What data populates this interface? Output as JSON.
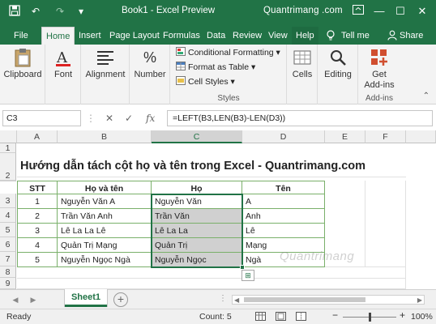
{
  "titlebar": {
    "title": "Book1 - Excel Preview",
    "brand": "Quantrimang .com",
    "undo_glyph": "↶",
    "redo_glyph": "↷",
    "qat_more_glyph": "▾",
    "minimize_glyph": "—",
    "restore_glyph": "☐",
    "close_glyph": "✕"
  },
  "tabs": [
    {
      "label": "File"
    },
    {
      "label": "Home"
    },
    {
      "label": "Insert"
    },
    {
      "label": "Page Layout"
    },
    {
      "label": "Formulas"
    },
    {
      "label": "Data"
    },
    {
      "label": "Review"
    },
    {
      "label": "View"
    },
    {
      "label": "Help"
    }
  ],
  "tell_me": "Tell me",
  "share": "Share",
  "ribbon": {
    "clipboard": "Clipboard",
    "font": "Font",
    "alignment": "Alignment",
    "number": "Number",
    "number_symbol": "%",
    "conditional_formatting": "Conditional Formatting",
    "format_as_table": "Format as Table",
    "cell_styles": "Cell Styles",
    "styles_group": "Styles",
    "cells": "Cells",
    "editing": "Editing",
    "get_addins_1": "Get",
    "get_addins_2": "Add-ins",
    "addins_group": "Add-ins"
  },
  "formula_bar": {
    "name_box": "C3",
    "formula": "=LEFT(B3,LEN(B3)-LEN(D3))",
    "cancel_glyph": "✕",
    "enter_glyph": "✓",
    "fx": "fx"
  },
  "columns": [
    "A",
    "B",
    "C",
    "D",
    "E",
    "F"
  ],
  "rows": [
    "1",
    "2",
    "3",
    "4",
    "5",
    "6",
    "7",
    "8",
    "9"
  ],
  "sheet": {
    "title": "Hướng dẫn tách cột họ và tên trong Excel - Quantrimang.com",
    "headers": [
      "STT",
      "Họ và tên",
      "Họ",
      "Tên"
    ],
    "data": [
      [
        "1",
        "Nguyễn Văn A",
        "Nguyễn Văn",
        "A"
      ],
      [
        "2",
        "Trần Văn Anh",
        "Trần Văn",
        "Anh"
      ],
      [
        "3",
        "Lê La La Lê",
        "Lê La La",
        "Lê"
      ],
      [
        "4",
        "Quản Trị Mạng",
        "Quản Trị",
        "Mạng"
      ],
      [
        "5",
        "Nguyễn Ngọc Ngà",
        "Nguyễn Ngọc",
        "Ngà"
      ]
    ]
  },
  "watermark": "Quantrimang",
  "sheet_tab": "Sheet1",
  "status": {
    "ready": "Ready",
    "count": "Count: 5",
    "zoom": "100%"
  }
}
